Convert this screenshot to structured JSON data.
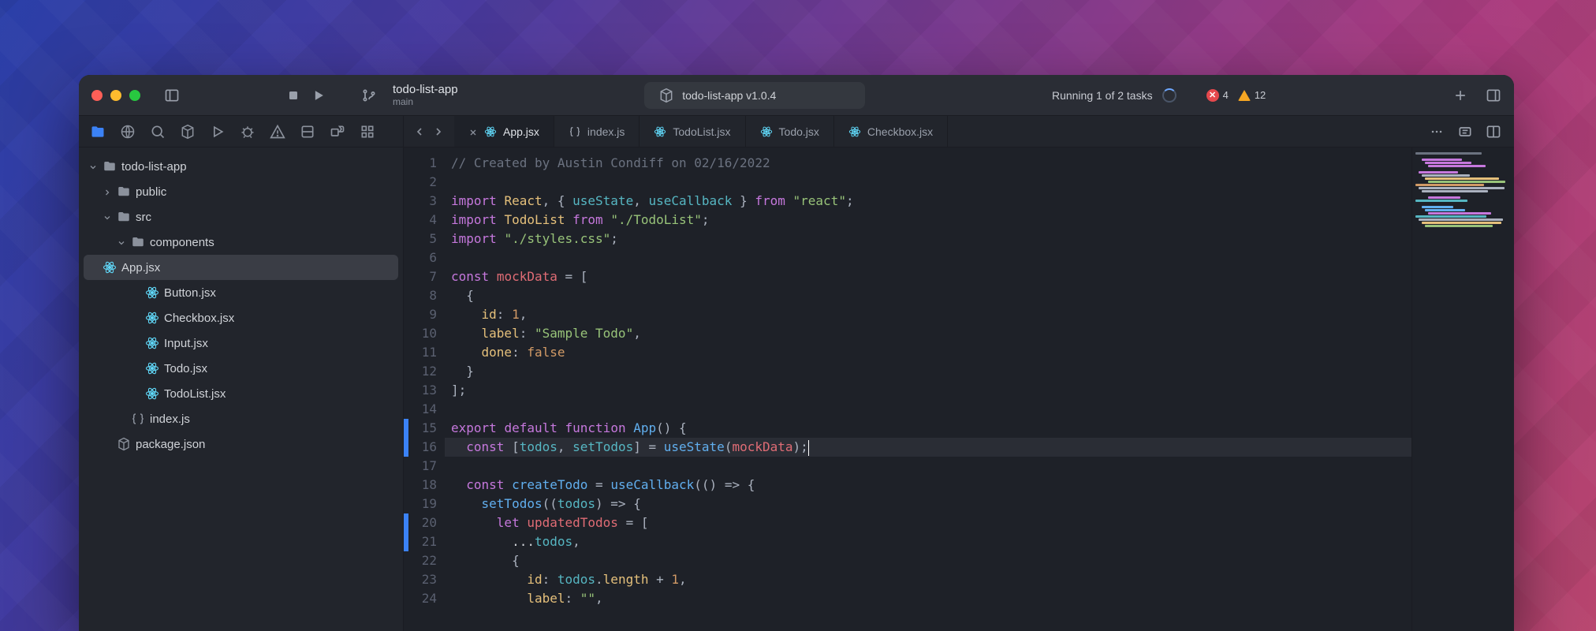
{
  "titlebar": {
    "project_name": "todo-list-app",
    "branch": "main",
    "build_label": "todo-list-app v1.0.4",
    "status": "Running 1 of 2 tasks",
    "errors": "4",
    "warnings": "12"
  },
  "sidebar": {
    "root": "todo-list-app",
    "items": [
      {
        "label": "public",
        "kind": "folder",
        "indent": 1,
        "expanded": false
      },
      {
        "label": "src",
        "kind": "folder",
        "indent": 1,
        "expanded": true
      },
      {
        "label": "components",
        "kind": "folder",
        "indent": 2,
        "expanded": true
      },
      {
        "label": "App.jsx",
        "kind": "react",
        "indent": 3,
        "selected": true
      },
      {
        "label": "Button.jsx",
        "kind": "react",
        "indent": 3
      },
      {
        "label": "Checkbox.jsx",
        "kind": "react",
        "indent": 3
      },
      {
        "label": "Input.jsx",
        "kind": "react",
        "indent": 3
      },
      {
        "label": "Todo.jsx",
        "kind": "react",
        "indent": 3
      },
      {
        "label": "TodoList.jsx",
        "kind": "react",
        "indent": 3
      },
      {
        "label": "index.js",
        "kind": "js",
        "indent": 2
      },
      {
        "label": "package.json",
        "kind": "pkg",
        "indent": 1
      }
    ]
  },
  "tabs": [
    {
      "label": "App.jsx",
      "icon": "react",
      "active": true,
      "closeable": true
    },
    {
      "label": "index.js",
      "icon": "js"
    },
    {
      "label": "TodoList.jsx",
      "icon": "react"
    },
    {
      "label": "Todo.jsx",
      "icon": "react"
    },
    {
      "label": "Checkbox.jsx",
      "icon": "react"
    }
  ],
  "editor": {
    "lines": [
      {
        "n": 1,
        "tokens": [
          [
            "c-comment",
            "// Created by Austin Condiff on 02/16/2022"
          ]
        ]
      },
      {
        "n": 2,
        "tokens": []
      },
      {
        "n": 3,
        "tokens": [
          [
            "c-kw",
            "import"
          ],
          [
            "",
            " "
          ],
          [
            "c-type",
            "React"
          ],
          [
            "c-punc",
            ", { "
          ],
          [
            "c-ident",
            "useState"
          ],
          [
            "c-punc",
            ", "
          ],
          [
            "c-ident",
            "useCallback"
          ],
          [
            "c-punc",
            " } "
          ],
          [
            "c-kw",
            "from"
          ],
          [
            "",
            " "
          ],
          [
            "c-str",
            "\"react\""
          ],
          [
            "c-punc",
            ";"
          ]
        ]
      },
      {
        "n": 4,
        "tokens": [
          [
            "c-kw",
            "import"
          ],
          [
            "",
            " "
          ],
          [
            "c-type",
            "TodoList"
          ],
          [
            "",
            " "
          ],
          [
            "c-kw",
            "from"
          ],
          [
            "",
            " "
          ],
          [
            "c-str",
            "\"./TodoList\""
          ],
          [
            "c-punc",
            ";"
          ]
        ]
      },
      {
        "n": 5,
        "tokens": [
          [
            "c-kw",
            "import"
          ],
          [
            "",
            " "
          ],
          [
            "c-str",
            "\"./styles.css\""
          ],
          [
            "c-punc",
            ";"
          ]
        ]
      },
      {
        "n": 6,
        "tokens": []
      },
      {
        "n": 7,
        "tokens": [
          [
            "c-kw",
            "const"
          ],
          [
            "",
            " "
          ],
          [
            "c-var",
            "mockData"
          ],
          [
            "",
            " "
          ],
          [
            "c-punc",
            "= ["
          ]
        ]
      },
      {
        "n": 8,
        "tokens": [
          [
            "",
            "  "
          ],
          [
            "c-punc",
            "{"
          ]
        ]
      },
      {
        "n": 9,
        "tokens": [
          [
            "",
            "    "
          ],
          [
            "c-prop",
            "id"
          ],
          [
            "c-punc",
            ": "
          ],
          [
            "c-num",
            "1"
          ],
          [
            "c-punc",
            ","
          ]
        ]
      },
      {
        "n": 10,
        "tokens": [
          [
            "",
            "    "
          ],
          [
            "c-prop",
            "label"
          ],
          [
            "c-punc",
            ": "
          ],
          [
            "c-str",
            "\"Sample Todo\""
          ],
          [
            "c-punc",
            ","
          ]
        ]
      },
      {
        "n": 11,
        "tokens": [
          [
            "",
            "    "
          ],
          [
            "c-prop",
            "done"
          ],
          [
            "c-punc",
            ": "
          ],
          [
            "c-bool",
            "false"
          ]
        ]
      },
      {
        "n": 12,
        "tokens": [
          [
            "",
            "  "
          ],
          [
            "c-punc",
            "}"
          ]
        ]
      },
      {
        "n": 13,
        "tokens": [
          [
            "c-punc",
            "];"
          ]
        ]
      },
      {
        "n": 14,
        "tokens": []
      },
      {
        "n": 15,
        "mark": true,
        "tokens": [
          [
            "c-kw",
            "export"
          ],
          [
            "",
            " "
          ],
          [
            "c-kw",
            "default"
          ],
          [
            "",
            " "
          ],
          [
            "c-kw",
            "function"
          ],
          [
            "",
            " "
          ],
          [
            "c-fn",
            "App"
          ],
          [
            "c-punc",
            "() {"
          ]
        ]
      },
      {
        "n": 16,
        "hl": true,
        "mark": true,
        "cursor": true,
        "tokens": [
          [
            "",
            "  "
          ],
          [
            "c-kw",
            "const"
          ],
          [
            "",
            " "
          ],
          [
            "c-punc",
            "["
          ],
          [
            "c-ident",
            "todos"
          ],
          [
            "c-punc",
            ", "
          ],
          [
            "c-ident",
            "setTodos"
          ],
          [
            "c-punc",
            "] = "
          ],
          [
            "c-fn",
            "useState"
          ],
          [
            "c-punc",
            "("
          ],
          [
            "c-var",
            "mockData"
          ],
          [
            "c-punc",
            ");"
          ]
        ]
      },
      {
        "n": 17,
        "tokens": []
      },
      {
        "n": 18,
        "tokens": [
          [
            "",
            "  "
          ],
          [
            "c-kw",
            "const"
          ],
          [
            "",
            " "
          ],
          [
            "c-fn",
            "createTodo"
          ],
          [
            "",
            " "
          ],
          [
            "c-punc",
            "= "
          ],
          [
            "c-fn",
            "useCallback"
          ],
          [
            "c-punc",
            "(() => {"
          ]
        ]
      },
      {
        "n": 19,
        "tokens": [
          [
            "",
            "    "
          ],
          [
            "c-fn",
            "setTodos"
          ],
          [
            "c-punc",
            "(("
          ],
          [
            "c-ident",
            "todos"
          ],
          [
            "c-punc",
            ") => {"
          ]
        ]
      },
      {
        "n": 20,
        "mark": true,
        "tokens": [
          [
            "",
            "      "
          ],
          [
            "c-kw",
            "let"
          ],
          [
            "",
            " "
          ],
          [
            "c-var",
            "updatedTodos"
          ],
          [
            "",
            " "
          ],
          [
            "c-punc",
            "= ["
          ]
        ]
      },
      {
        "n": 21,
        "mark": true,
        "tokens": [
          [
            "",
            "        ..."
          ],
          [
            "c-ident",
            "todos"
          ],
          [
            "c-punc",
            ","
          ]
        ]
      },
      {
        "n": 22,
        "tokens": [
          [
            "",
            "        "
          ],
          [
            "c-punc",
            "{"
          ]
        ]
      },
      {
        "n": 23,
        "tokens": [
          [
            "",
            "          "
          ],
          [
            "c-prop",
            "id"
          ],
          [
            "c-punc",
            ": "
          ],
          [
            "c-ident",
            "todos"
          ],
          [
            "c-punc",
            "."
          ],
          [
            "c-prop",
            "length"
          ],
          [
            "",
            " "
          ],
          [
            "c-punc",
            "+ "
          ],
          [
            "c-num",
            "1"
          ],
          [
            "c-punc",
            ","
          ]
        ]
      },
      {
        "n": 24,
        "tokens": [
          [
            "",
            "          "
          ],
          [
            "c-prop",
            "label"
          ],
          [
            "c-punc",
            ": "
          ],
          [
            "c-str",
            "\"\""
          ],
          [
            "c-punc",
            ","
          ]
        ]
      }
    ]
  }
}
